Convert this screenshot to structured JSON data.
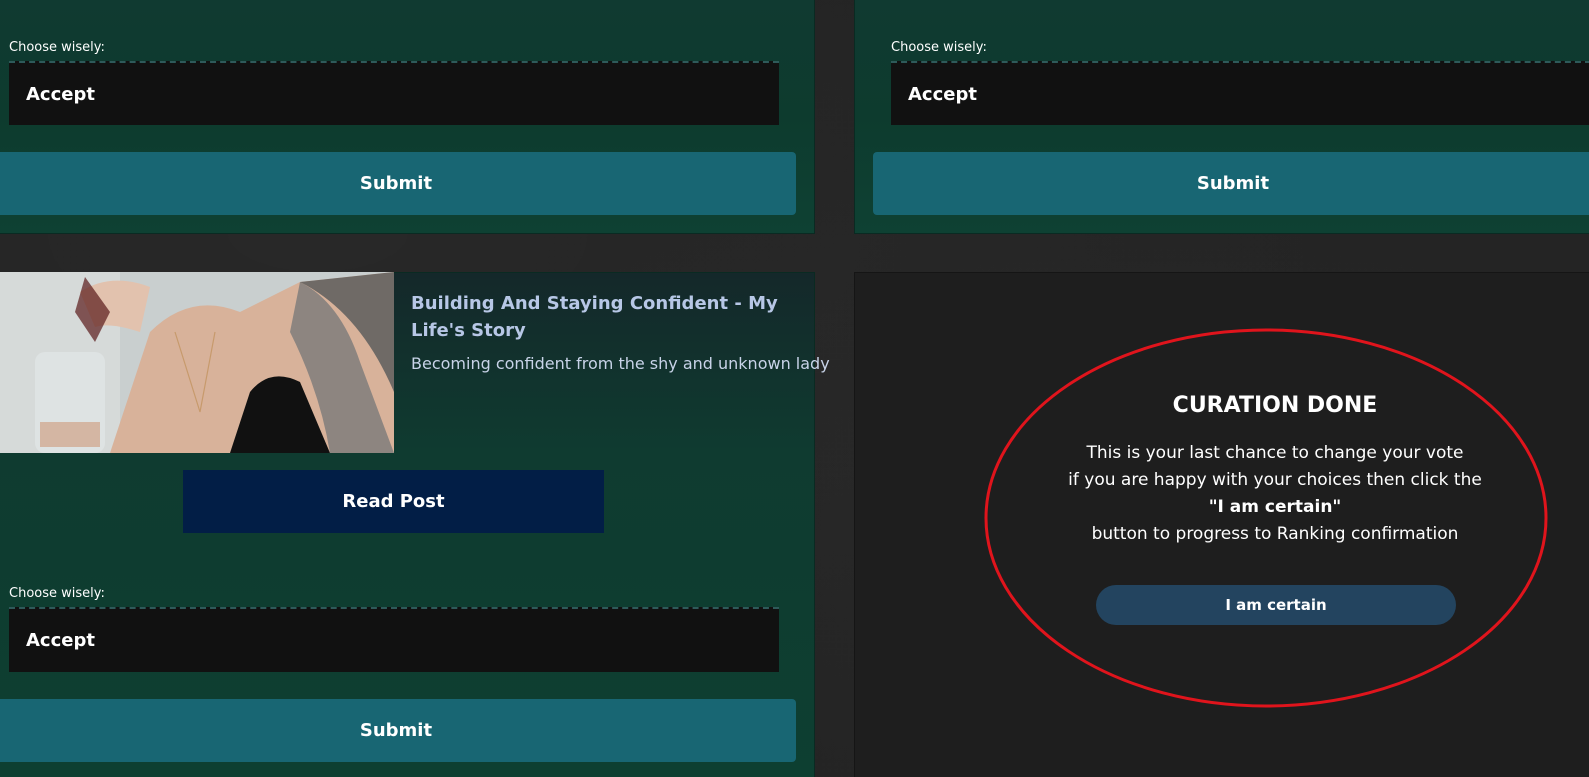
{
  "cards": [
    {
      "choose_label": "Choose wisely:",
      "select_value": "Accept",
      "submit_label": "Submit"
    },
    {
      "choose_label": "Choose wisely:",
      "select_value": "Accept",
      "submit_label": "Submit"
    },
    {
      "post_title": "Building And Staying Confident - My Life's Story",
      "post_description": "Becoming confident from the shy and unknown lady",
      "read_label": "Read Post",
      "choose_label": "Choose wisely:",
      "select_value": "Accept",
      "submit_label": "Submit"
    }
  ],
  "curation": {
    "title": "CURATION DONE",
    "line1": "This is your last chance to change your vote",
    "line2": "if you are happy with your choices then click the",
    "line3": "\"I am certain\"",
    "line4": "button to progress to Ranking confirmation",
    "button_label": "I am certain",
    "annotation_color": "#e0141c"
  }
}
